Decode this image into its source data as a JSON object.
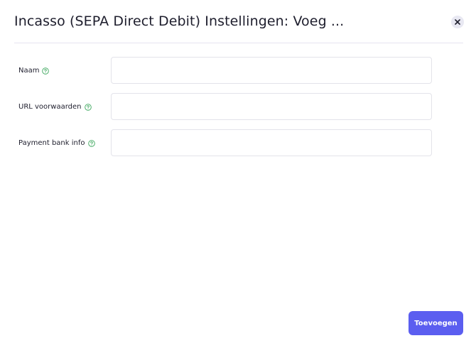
{
  "modal": {
    "title": "Incasso (SEPA Direct Debit) Instellingen: Voeg ...",
    "close_icon": "close-icon"
  },
  "form": {
    "fields": [
      {
        "label": "Naam",
        "value": "",
        "placeholder": "",
        "help_icon": "question-circle-icon"
      },
      {
        "label": "URL voorwaarden",
        "value": "",
        "placeholder": "",
        "help_icon": "question-circle-icon"
      },
      {
        "label": "Payment bank info",
        "value": "",
        "placeholder": "",
        "help_icon": "question-circle-icon"
      }
    ]
  },
  "footer": {
    "submit_label": "Toevoegen"
  },
  "colors": {
    "accent": "#5b5ef0",
    "help_icon": "#3aa65b",
    "divider": "#e6e4f0",
    "input_border": "#e3e3ea"
  }
}
